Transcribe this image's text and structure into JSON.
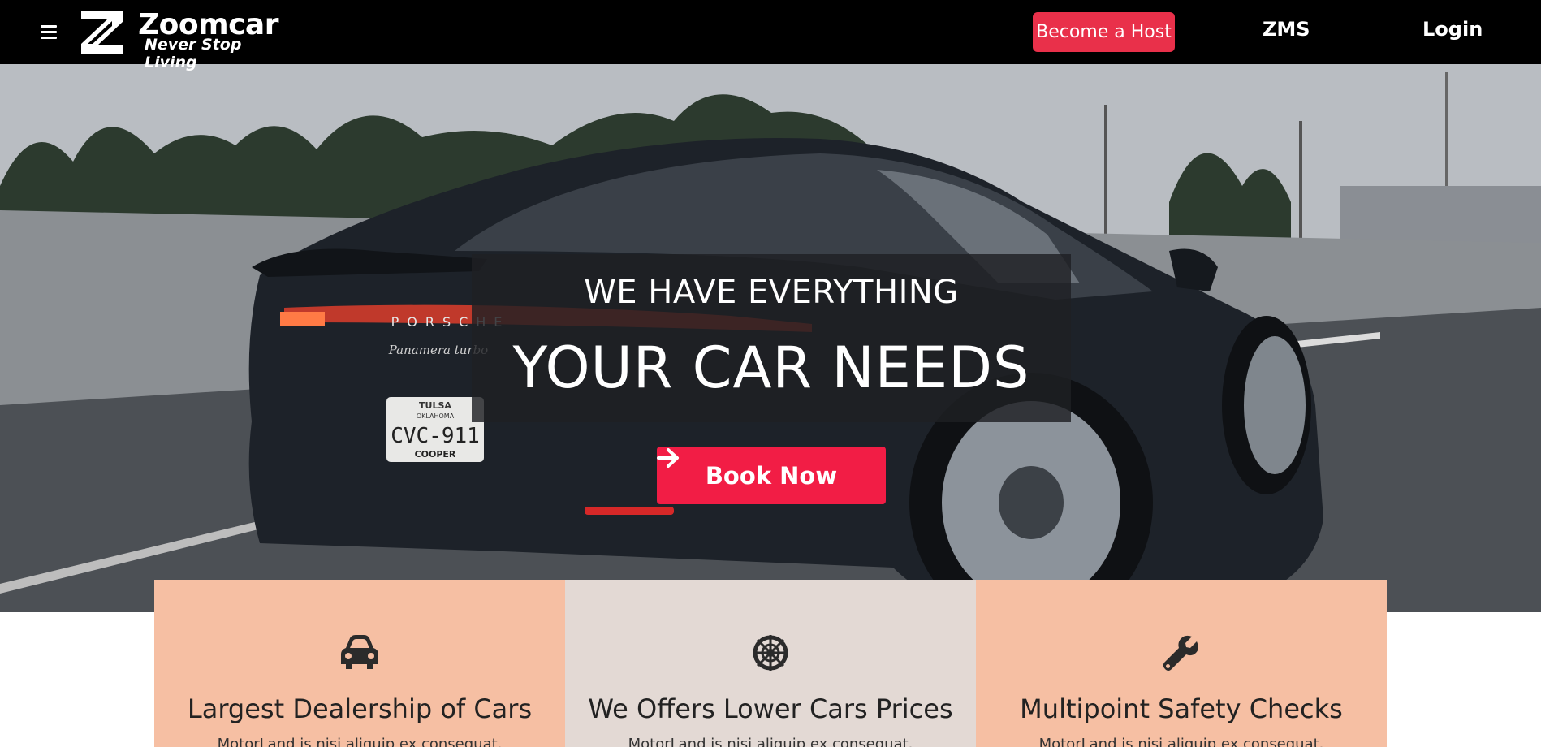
{
  "header": {
    "brand_name": "Zoomcar",
    "brand_tagline": "Never Stop Living",
    "host_button": "Become a Host",
    "nav_zms": "ZMS",
    "nav_login": "Login"
  },
  "hero": {
    "line1": "WE HAVE EVERYTHING",
    "line2": "YOUR CAR NEEDS",
    "cta_label": "Book Now",
    "plate_text": "CVC-911",
    "plate_state": "OKLAHOMA",
    "plate_top": "TULSA",
    "plate_bottom": "COOPER",
    "car_badge": "PORSCHE",
    "car_model": "Panamera turbo"
  },
  "features": [
    {
      "icon": "car-icon",
      "title": "Largest Dealership of Cars",
      "text": "MotorLand is nisi aliquip ex consequat.",
      "bg": "#f6bfa3"
    },
    {
      "icon": "steering-wheel-icon",
      "title": "We Offers Lower Cars Prices",
      "text": "MotorLand is nisi aliquip ex consequat.",
      "bg": "#e3d9d4"
    },
    {
      "icon": "wrench-icon",
      "title": "Multipoint Safety Checks",
      "text": "MotorLand is nisi aliquip ex consequat.",
      "bg": "#f6bfa3"
    }
  ],
  "colors": {
    "accent": "#f21d45",
    "host_button": "#e9304a",
    "navbar": "#000000"
  }
}
